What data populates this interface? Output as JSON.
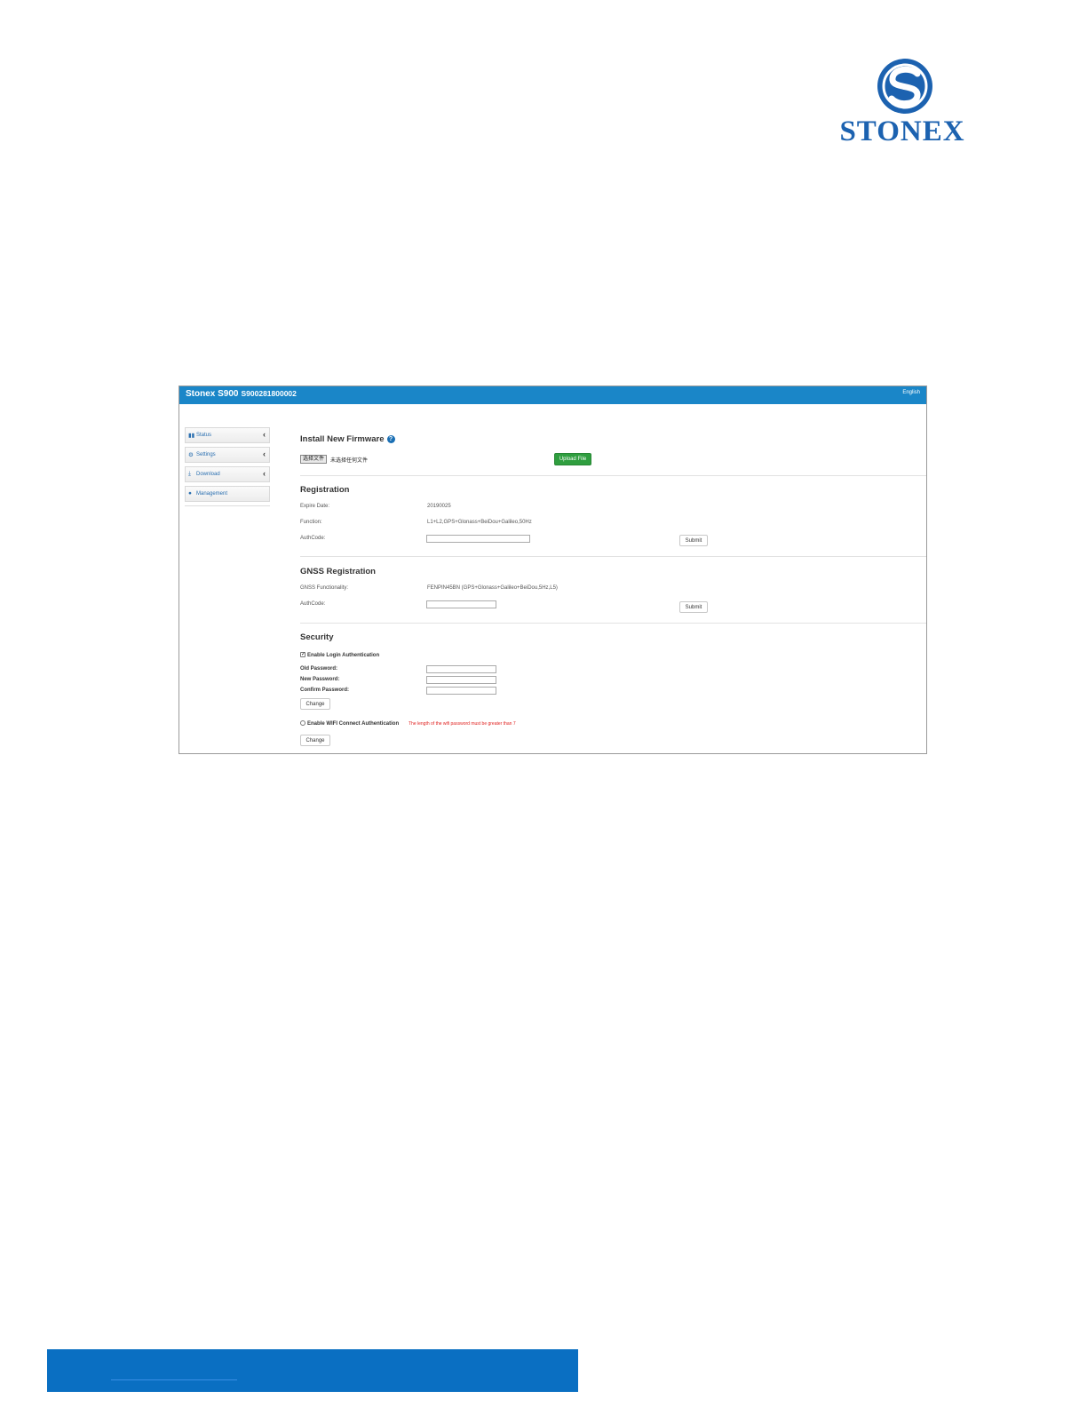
{
  "logo": {
    "text": "STONEX",
    "icon": "stonex-s-logo"
  },
  "app": {
    "name": "Stonex S900",
    "serial": "S900281800002",
    "language": "English"
  },
  "sidebar": {
    "items": [
      {
        "label": "Status",
        "icon": "grid-icon",
        "glyph": "▮▮"
      },
      {
        "label": "Settings",
        "icon": "gear-icon",
        "glyph": "⚙"
      },
      {
        "label": "Download",
        "icon": "download-icon",
        "glyph": "⤓"
      },
      {
        "label": "Management",
        "icon": "info-icon",
        "glyph": "●"
      }
    ],
    "chevron": "‹"
  },
  "firmware": {
    "title": "Install New Firmware",
    "choose_file": "选择文件",
    "no_file": "未选择任何文件",
    "upload_label": "Upload File"
  },
  "registration": {
    "title": "Registration",
    "expire_label": "Expire Date:",
    "expire_value": "20190025",
    "function_label": "Function:",
    "function_value": "L1+L2,GPS+Glonass+BeiDou+Galileo,50Hz",
    "authcode_label": "AuthCode:",
    "submit_label": "Submit"
  },
  "gnss": {
    "title": "GNSS Registration",
    "functionality_label": "GNSS Functionality:",
    "functionality_value": "FENPIN45BN (GPS+Glonass+Galileo+BeiDou,5Hz,L5)",
    "authcode_label": "AuthCode:",
    "submit_label": "Submit"
  },
  "security": {
    "title": "Security",
    "enable_login": "Enable Login Authentication",
    "old_password": "Old Password:",
    "new_password": "New Password:",
    "confirm_password": "Confirm Password:",
    "change_label": "Change",
    "enable_wifi": "Enable WIFI Connect Authentication",
    "wifi_warning": "The length of the wifi password must be greater than 7",
    "change2_label": "Change"
  },
  "colors": {
    "topbar": "#1a86c8",
    "upload_button": "#2f9e3f",
    "footer": "#0a6fc2",
    "logo": "#1c62b0",
    "warning": "#e0201e"
  }
}
